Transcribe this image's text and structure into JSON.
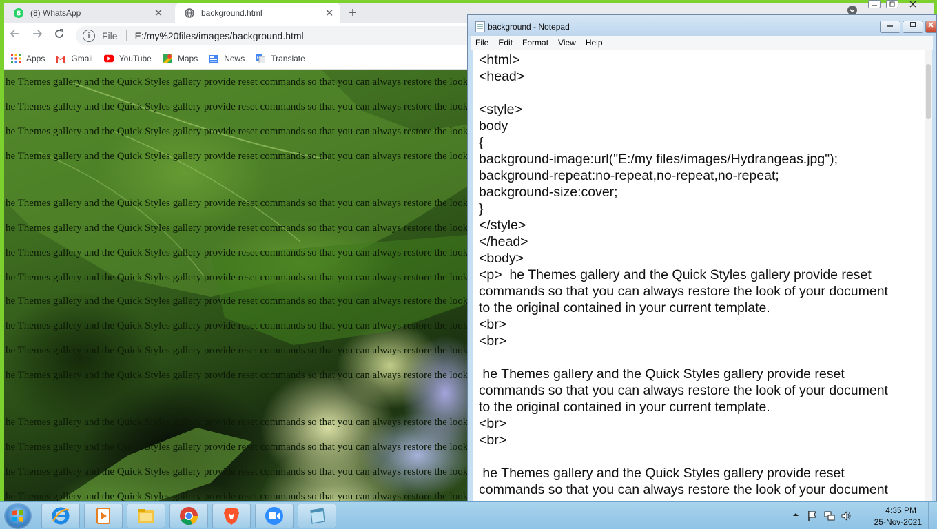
{
  "chrome": {
    "tabs": [
      {
        "title": "(8) WhatsApp",
        "close": "✕"
      },
      {
        "title": "background.html",
        "close": "✕"
      }
    ],
    "new_tab": "+",
    "address": {
      "scheme": "File",
      "url": "E:/my%20files/images/background.html"
    },
    "bookmarks": [
      {
        "label": "Apps",
        "icon": "apps-grid-icon"
      },
      {
        "label": "Gmail",
        "icon": "gmail-icon"
      },
      {
        "label": "YouTube",
        "icon": "youtube-icon"
      },
      {
        "label": "Maps",
        "icon": "maps-icon"
      },
      {
        "label": "News",
        "icon": "news-icon"
      },
      {
        "label": "Translate",
        "icon": "translate-icon"
      }
    ],
    "page_lines": [
      "he Themes gallery and the Quick Styles gallery provide reset commands so that you can always restore the look of your document to the original contained in your current template.",
      "he Themes gallery and the Quick Styles gallery provide reset commands so that you can always restore the look of your document to the original contained in your current template.",
      "he Themes gallery and the Quick Styles gallery provide reset commands so that you can always restore the look of your document to the original contained in your current template.",
      "he Themes gallery and the Quick Styles gallery provide reset commands so that you can always restore the look of your document to the original contained in your current template.",
      "he Themes gallery and the Quick Styles gallery provide reset commands so that you can always restore the look of your document to the original contained in your current template.",
      "he Themes gallery and the Quick Styles gallery provide reset commands so that you can always restore the look of your document to the original contained in your current template.",
      "he Themes gallery and the Quick Styles gallery provide reset commands so that you can always restore the look of your document to the original contained in your current template.",
      "he Themes gallery and the Quick Styles gallery provide reset commands so that you can always restore the look of your document to the original contained in your current template.",
      "he Themes gallery and the Quick Styles gallery provide reset commands so that you can always restore the look of your document to the original contained in your current template.",
      "he Themes gallery and the Quick Styles gallery provide reset commands so that you can always restore the look of your document to the original contained in your current template.",
      "he Themes gallery and the Quick Styles gallery provide reset commands so that you can always restore the look of your document to the original contained in your current template.",
      "he Themes gallery and the Quick Styles gallery provide reset commands so that you can always restore the look of your document to the original contained in your current template.",
      "he Themes gallery and the Quick Styles gallery provide reset commands so that you can always restore the look of your document to the original contained in your current template.",
      "he Themes gallery and the Quick Styles gallery provide reset commands so that you can always restore the look of your document to the original contained in your current template.",
      "he Themes gallery and the Quick Styles gallery provide reset commands so that you can always restore the look of your document to the original contained in your current template.",
      "he Themes gallery and the Quick Styles gallery provide reset commands so that you can always restore the look of your document to the original contained in your current template."
    ]
  },
  "notepad": {
    "title": "background - Notepad",
    "menus": [
      "File",
      "Edit",
      "Format",
      "View",
      "Help"
    ],
    "lines": [
      "<html>",
      "<head>",
      "",
      "<style>",
      "body",
      "{",
      "background-image:url(\"E:/my files/images/Hydrangeas.jpg\");",
      "background-repeat:no-repeat,no-repeat,no-repeat;",
      "background-size:cover;",
      "}",
      "</style>",
      "</head>",
      "<body>",
      "<p>  he Themes gallery and the Quick Styles gallery provide reset",
      "commands so that you can always restore the look of your document",
      "to the original contained in your current template.",
      "<br>",
      "<br>",
      "",
      " he Themes gallery and the Quick Styles gallery provide reset",
      "commands so that you can always restore the look of your document",
      "to the original contained in your current template.",
      "<br>",
      "<br>",
      "",
      " he Themes gallery and the Quick Styles gallery provide reset",
      "commands so that you can always restore the look of your document"
    ]
  },
  "taskbar": {
    "items": [
      "internet-explorer-icon",
      "media-player-icon",
      "file-explorer-icon",
      "chrome-icon",
      "brave-icon",
      "zoom-icon",
      "notepad-icon"
    ],
    "clock_time": "4:35 PM",
    "clock_date": "25-Nov-2021"
  }
}
